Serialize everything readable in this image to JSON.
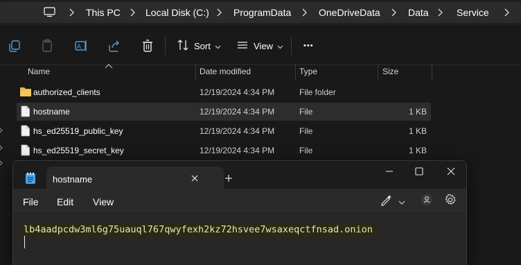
{
  "breadcrumb": [
    "This PC",
    "Local Disk (C:)",
    "ProgramData",
    "OneDriveData",
    "Data",
    "Service"
  ],
  "toolbar": {
    "sort_label": "Sort",
    "view_label": "View",
    "more_label": "•••"
  },
  "columns": {
    "name": "Name",
    "date": "Date modified",
    "type": "Type",
    "size": "Size"
  },
  "files": [
    {
      "name": "authorized_clients",
      "date": "12/19/2024 4:34 PM",
      "type": "File folder",
      "size": "",
      "icon": "folder-icon"
    },
    {
      "name": "hostname",
      "date": "12/19/2024 4:34 PM",
      "type": "File",
      "size": "1 KB",
      "icon": "file-icon",
      "selected": true
    },
    {
      "name": "hs_ed25519_public_key",
      "date": "12/19/2024 4:34 PM",
      "type": "File",
      "size": "1 KB",
      "icon": "file-icon"
    },
    {
      "name": "hs_ed25519_secret_key",
      "date": "12/19/2024 4:34 PM",
      "type": "File",
      "size": "1 KB",
      "icon": "file-icon"
    }
  ],
  "notepad": {
    "tab_title": "hostname",
    "menu": [
      "File",
      "Edit",
      "View"
    ],
    "content": "lb4aadpcdw3ml6g75uauql767qwyfexh2kz72hsvee7wsaxeqctfnsad.onion"
  },
  "colors": {
    "folder": "#e8b64a",
    "accent_selection": "#2d2d2d",
    "highlight": "#2a2a14"
  }
}
